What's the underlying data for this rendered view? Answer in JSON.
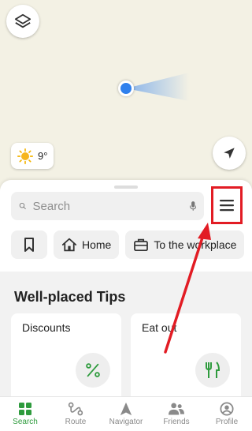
{
  "map": {
    "weather_temp": "9°",
    "icons": {
      "layers": "layers-icon",
      "compass": "navigation-arrow-icon",
      "sun": "sun-icon"
    }
  },
  "search": {
    "placeholder": "Search",
    "icons": {
      "search": "search-icon",
      "mic": "microphone-icon",
      "menu": "hamburger-menu-icon"
    }
  },
  "chips": [
    {
      "icon": "bookmark-icon",
      "label": ""
    },
    {
      "icon": "home-icon",
      "label": "Home"
    },
    {
      "icon": "briefcase-icon",
      "label": "To the workplace"
    }
  ],
  "tips": {
    "title": "Well-placed Tips",
    "cards": [
      {
        "label": "Discounts",
        "icon": "percent-icon"
      },
      {
        "label": "Eat out",
        "icon": "fork-knife-icon"
      }
    ]
  },
  "nav": [
    {
      "label": "Search",
      "icon": "grid-icon",
      "active": true
    },
    {
      "label": "Route",
      "icon": "route-icon",
      "active": false
    },
    {
      "label": "Navigator",
      "icon": "navigator-icon",
      "active": false
    },
    {
      "label": "Friends",
      "icon": "friends-icon",
      "active": false
    },
    {
      "label": "Profile",
      "icon": "profile-icon",
      "active": false
    }
  ],
  "colors": {
    "accent": "#2e9b3d",
    "highlight": "#e21c24",
    "location": "#2f80ed"
  }
}
